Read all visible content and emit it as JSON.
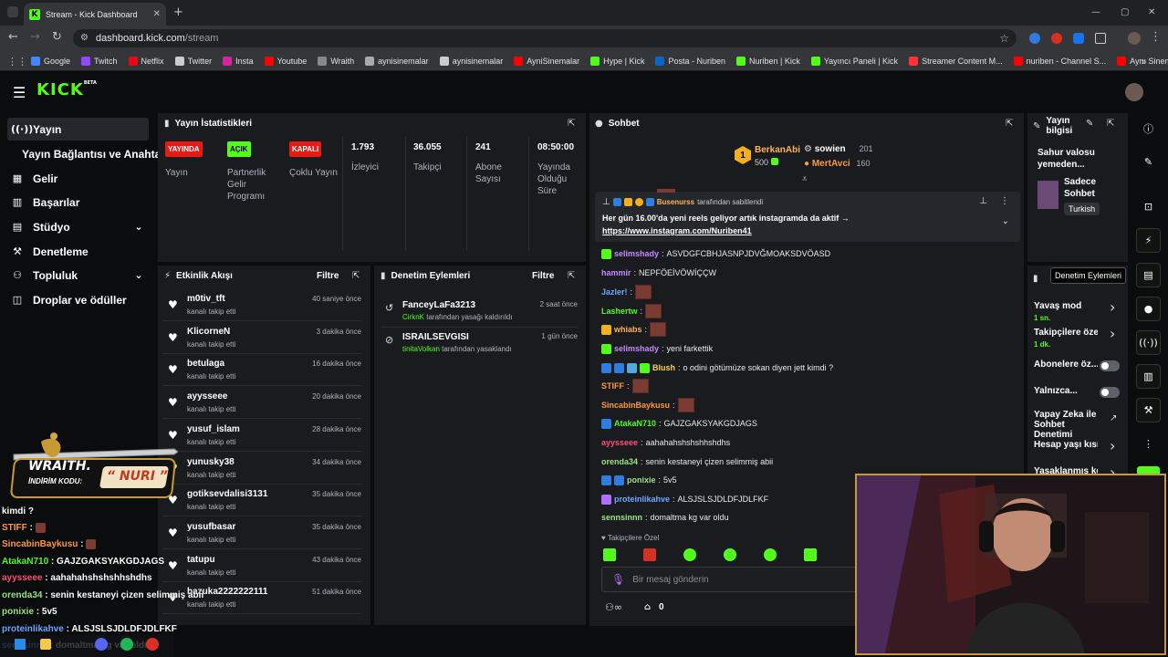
{
  "browser": {
    "tab_title": "Stream - Kick Dashboard",
    "url_domain": "dashboard.kick.com",
    "url_path": "/stream",
    "bookmarks": [
      {
        "label": "Google",
        "color": "#4285f4"
      },
      {
        "label": "Twitch",
        "color": "#9146ff"
      },
      {
        "label": "Netflix",
        "color": "#e50914"
      },
      {
        "label": "Twitter",
        "color": "#cccccc"
      },
      {
        "label": "Insta",
        "color": "#d6249f"
      },
      {
        "label": "Youtube",
        "color": "#ff0000"
      },
      {
        "label": "Wraith",
        "color": "#888888"
      },
      {
        "label": "aynisinemalar",
        "color": "#aaaaaa"
      },
      {
        "label": "aynisinemalar",
        "color": "#cccccc"
      },
      {
        "label": "AyniSinemalar",
        "color": "#ff0000"
      },
      {
        "label": "Hype | Kick",
        "color": "#53fc18"
      },
      {
        "label": "Posta - Nuriben",
        "color": "#0a66c2"
      },
      {
        "label": "Nuriben | Kick",
        "color": "#53fc18"
      },
      {
        "label": "Yayıncı Paneli | Kick",
        "color": "#53fc18"
      },
      {
        "label": "Streamer Content M...",
        "color": "#ff3333"
      },
      {
        "label": "nuriben - Channel S...",
        "color": "#ff0000"
      },
      {
        "label": "Aynı Sinemalar - Ça...",
        "color": "#ff0000"
      }
    ]
  },
  "app": {
    "logo": "KICK",
    "beta": "BETA"
  },
  "sidebar": {
    "items": [
      {
        "label": "Yayın",
        "icon": "broadcast-icon"
      },
      {
        "label": "Yayın Bağlantısı ve Anahtarı",
        "icon": ""
      },
      {
        "label": "Gelir",
        "icon": "revenue-icon"
      },
      {
        "label": "Başarılar",
        "icon": "achievements-icon"
      },
      {
        "label": "Stüdyo",
        "icon": "studio-icon"
      },
      {
        "label": "Denetleme",
        "icon": "moderation-icon"
      },
      {
        "label": "Topluluk",
        "icon": "community-icon"
      },
      {
        "label": "Droplar ve ödüller",
        "icon": "drops-icon"
      }
    ]
  },
  "stats": {
    "title": "Yayın İstatistikleri",
    "items": [
      {
        "badge": "YAYINDA",
        "badge_color": "#e91916",
        "label": "Yayın"
      },
      {
        "badge": "AÇIK",
        "badge_color": "#53fc18",
        "label": "Partnerlik Gelir Programı"
      },
      {
        "badge": "KAPALI",
        "badge_color": "#e91916",
        "label": "Çoklu Yayın"
      },
      {
        "value": "1.793",
        "label": "İzleyici"
      },
      {
        "value": "36.055",
        "label": "Takipçi"
      },
      {
        "value": "241",
        "label": "Abone Sayısı"
      },
      {
        "value": "08:50:00",
        "label": "Yayında Olduğu Süre"
      }
    ]
  },
  "activity": {
    "title": "Etkinlik Akışı",
    "filter": "Filtre",
    "items": [
      {
        "name": "m0tiv_tft",
        "sub": "kanalı takip etti",
        "time": "40 saniye önce"
      },
      {
        "name": "KlicorneN",
        "sub": "kanalı takip etti",
        "time": "3 dakika önce"
      },
      {
        "name": "betulaga",
        "sub": "kanalı takip etti",
        "time": "16 dakika önce"
      },
      {
        "name": "ayysseee",
        "sub": "kanalı takip etti",
        "time": "20 dakika önce"
      },
      {
        "name": "yusuf_islam",
        "sub": "kanalı takip etti",
        "time": "28 dakika önce"
      },
      {
        "name": "yunusky38",
        "sub": "kanalı takip etti",
        "time": "34 dakika önce"
      },
      {
        "name": "gotiksevdalisi3131",
        "sub": "kanalı takip etti",
        "time": "35 dakika önce"
      },
      {
        "name": "yusufbasar",
        "sub": "kanalı takip etti",
        "time": "35 dakika önce"
      },
      {
        "name": "tatupu",
        "sub": "kanalı takip etti",
        "time": "43 dakika önce"
      },
      {
        "name": "bazuka2222222111",
        "sub": "kanalı takip etti",
        "time": "51 dakika önce"
      }
    ]
  },
  "modlog": {
    "title": "Denetim Eylemleri",
    "filter": "Filtre",
    "items": [
      {
        "name": "FanceyLaFa3213",
        "actor": "CirknK",
        "action": "tarafından yasağı kaldırıldı",
        "time": "2 saat önce"
      },
      {
        "name": "ISRAILSEVGISI",
        "actor": "tinitaVolkan",
        "action": "tarafından yasaklandı",
        "time": "1 gün önce"
      }
    ]
  },
  "chat": {
    "title": "Sohbet",
    "leaderboard": [
      {
        "rank": "1",
        "name": "BerkanAbi",
        "value": "500"
      },
      {
        "name": "sowien",
        "value": "201"
      },
      {
        "name": "MertAvci",
        "value": "160"
      }
    ],
    "pinned": {
      "by": "Busenurss",
      "by_suffix": "tarafından sabitlendi",
      "text": "Her gün 16.00'da yeni reels geliyor artık instagramda da aktif →",
      "link": "https://www.instagram.com/Nuriben41"
    },
    "messages": [
      {
        "user": "selimshady",
        "color": "#c58bff",
        "text": "ASVDGFCBHJASNPJDVĞMOAKSDVÖASD"
      },
      {
        "user": "hammir",
        "color": "#c58bff",
        "text": "NEPFÖEİVÖWİÇÇW"
      },
      {
        "user": "Jazler!",
        "color": "#6ea8ff",
        "text": ""
      },
      {
        "user": "Lashertw",
        "color": "#53fc18",
        "text": ""
      },
      {
        "user": "whiabs",
        "color": "#ffb35c",
        "text": ""
      },
      {
        "user": "selimshady",
        "color": "#c58bff",
        "text": "yeni farkettik"
      },
      {
        "user": "Blush",
        "color": "#ffd23f",
        "text": "o odini götümüze sokan diyen jett kimdi ?"
      },
      {
        "user": "STIFF",
        "color": "#ff9a3c",
        "text": ""
      },
      {
        "user": "SincabinBaykusu",
        "color": "#ff9a3c",
        "text": ""
      },
      {
        "user": "AtakaN710",
        "color": "#53fc18",
        "text": "GAJZGAKSYAKGDJAGS"
      },
      {
        "user": "ayysseee",
        "color": "#ff4f7a",
        "text": "aahahahshshshhshdhs"
      },
      {
        "user": "orenda34",
        "color": "#9be37f",
        "text": "senin kestaneyi çizen selimmiş abii"
      },
      {
        "user": "ponixie",
        "color": "#9be37f",
        "text": "5v5"
      },
      {
        "user": "proteinlikahve",
        "color": "#6ea8ff",
        "text": "ALSJSLSJDLDFJDLFKF"
      },
      {
        "user": "sennsinnn",
        "color": "#9be37f",
        "text": "domaltma kg var oldu"
      }
    ],
    "followers_only": "Takipçilere Özel",
    "input_placeholder": "Bir mesaj gönderin",
    "count": "0"
  },
  "streaminfo": {
    "title": "Yayın bilgisi",
    "stream_title": "Sahur valosu yemeden...",
    "category": "Sadece Sohbet",
    "language": "Turkish"
  },
  "modactions": {
    "tooltip": "Denetim Eylemleri",
    "items": [
      {
        "label": "Yavaş mod",
        "sub": "1 sn.",
        "type": "chevron"
      },
      {
        "label": "Takipçilere özel s",
        "sub": "1 dk.",
        "type": "chevron"
      },
      {
        "label": "Abonelere öz...",
        "sub": "",
        "type": "toggle"
      },
      {
        "label": "Yalnızca...",
        "sub": "",
        "type": "toggle"
      },
      {
        "label": "Yapay Zeka ile Sohbet Denetimi",
        "sub": "",
        "type": "link"
      },
      {
        "label": "Hesap yaşı kısıtla",
        "sub": "",
        "type": "chevron"
      },
      {
        "label": "Yasaklanmış kelin",
        "sub": "",
        "type": "chevron"
      }
    ]
  },
  "overlay": {
    "sponsor_title": "WRAITH.",
    "sponsor_code_label": "İNDİRİM KODU:",
    "sponsor_code": "NURI",
    "chat": [
      {
        "user": "",
        "text": "kimdi ?"
      },
      {
        "user": "STIFF",
        "text": ""
      },
      {
        "user": "SincabinBaykusu",
        "text": ""
      },
      {
        "user": "AtakaN710",
        "text": "GAJZGAKSYAKGDJAGS"
      },
      {
        "user": "ayysseee",
        "text": "aahahahshshshhshdhs"
      },
      {
        "user": "orenda34",
        "text": "senin kestaneyi çizen selimmiş abii"
      },
      {
        "user": "ponixie",
        "text": "5v5"
      },
      {
        "user": "proteinlikahve",
        "text": "ALSJSLSJDLDFJDLFKF"
      },
      {
        "user": "sennsinnn",
        "text": "domaltma kg var oldu"
      }
    ]
  }
}
